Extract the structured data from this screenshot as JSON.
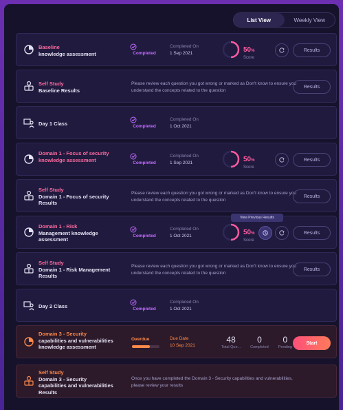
{
  "view_toggle": {
    "list": "List View",
    "weekly": "Weekly View"
  },
  "tooltip": "View Previous Results",
  "rows": [
    {
      "title_accent": "Baseline",
      "title": "knowledge assessment",
      "status": "Completed",
      "meta_key": "Completed On",
      "meta_value": "1 Sep 2021",
      "score": "50",
      "score_unit": "%",
      "score_label": "Score",
      "action": "Results"
    },
    {
      "title_accent": "Self Study",
      "title": "Baseline Results",
      "note": "Please review each question you got wrong or marked as Don't know to ensure you understand the concepts related to the question",
      "action": "Results"
    },
    {
      "title": "Day 1 Class",
      "status": "Completed",
      "meta_key": "Completed On",
      "meta_value": "1 Oct 2021"
    },
    {
      "title_accent": "Domain 1 - Focus of security knowledge assessment",
      "status": "Completed",
      "meta_key": "Completed On",
      "meta_value": "1 Sep 2021",
      "score": "50",
      "score_unit": "%",
      "score_label": "Score",
      "action": "Results"
    },
    {
      "title_accent": "Self Study",
      "title": "Domain 1 - Focus of security Results",
      "note": "Please review each question you got wrong or marked as Don't know to ensure you understand the concepts related to the question",
      "action": "Results"
    },
    {
      "title_accent": "Domain 1 - Risk",
      "title": "Management knowledge assessment",
      "status": "Completed",
      "meta_key": "Completed On",
      "meta_value": "1 Oct 2021",
      "score": "50",
      "score_unit": "%",
      "score_label": "Score",
      "action": "Results"
    },
    {
      "title_accent": "Self Study",
      "title": "Domain 1 - Risk Management Results",
      "note": "Please review each question you got wrong or marked as Don't know to ensure you understand the concepts related to the question",
      "action": "Results"
    },
    {
      "title": "Day 2 Class",
      "status": "Completed",
      "meta_key": "Completed On",
      "meta_value": "1 Oct 2021"
    },
    {
      "title_accent": "Domain 3 - Security",
      "title": "capabilities and vulnerabilities knowledge assessment",
      "status": "Overdue",
      "progress": 0.65,
      "meta_key": "Due Date",
      "meta_value": "10 Sep 2021",
      "stat_total": "48",
      "stat_total_label": "Total Que...",
      "stat_completed": "0",
      "stat_completed_label": "Completed",
      "stat_pending": "0",
      "stat_pending_label": "Pending",
      "action": "Start"
    },
    {
      "title_accent": "Self Study",
      "title": "Domain 3 - Security capabilities and vulnerabilities Results",
      "note": "Once you have completed the Domain 3 - Security capabilities and vulnerabilities, please review your results"
    }
  ],
  "colors": {
    "accent_pink": "#ff5a9e",
    "accent_purple": "#c36bff",
    "accent_orange": "#ff8a4a"
  }
}
